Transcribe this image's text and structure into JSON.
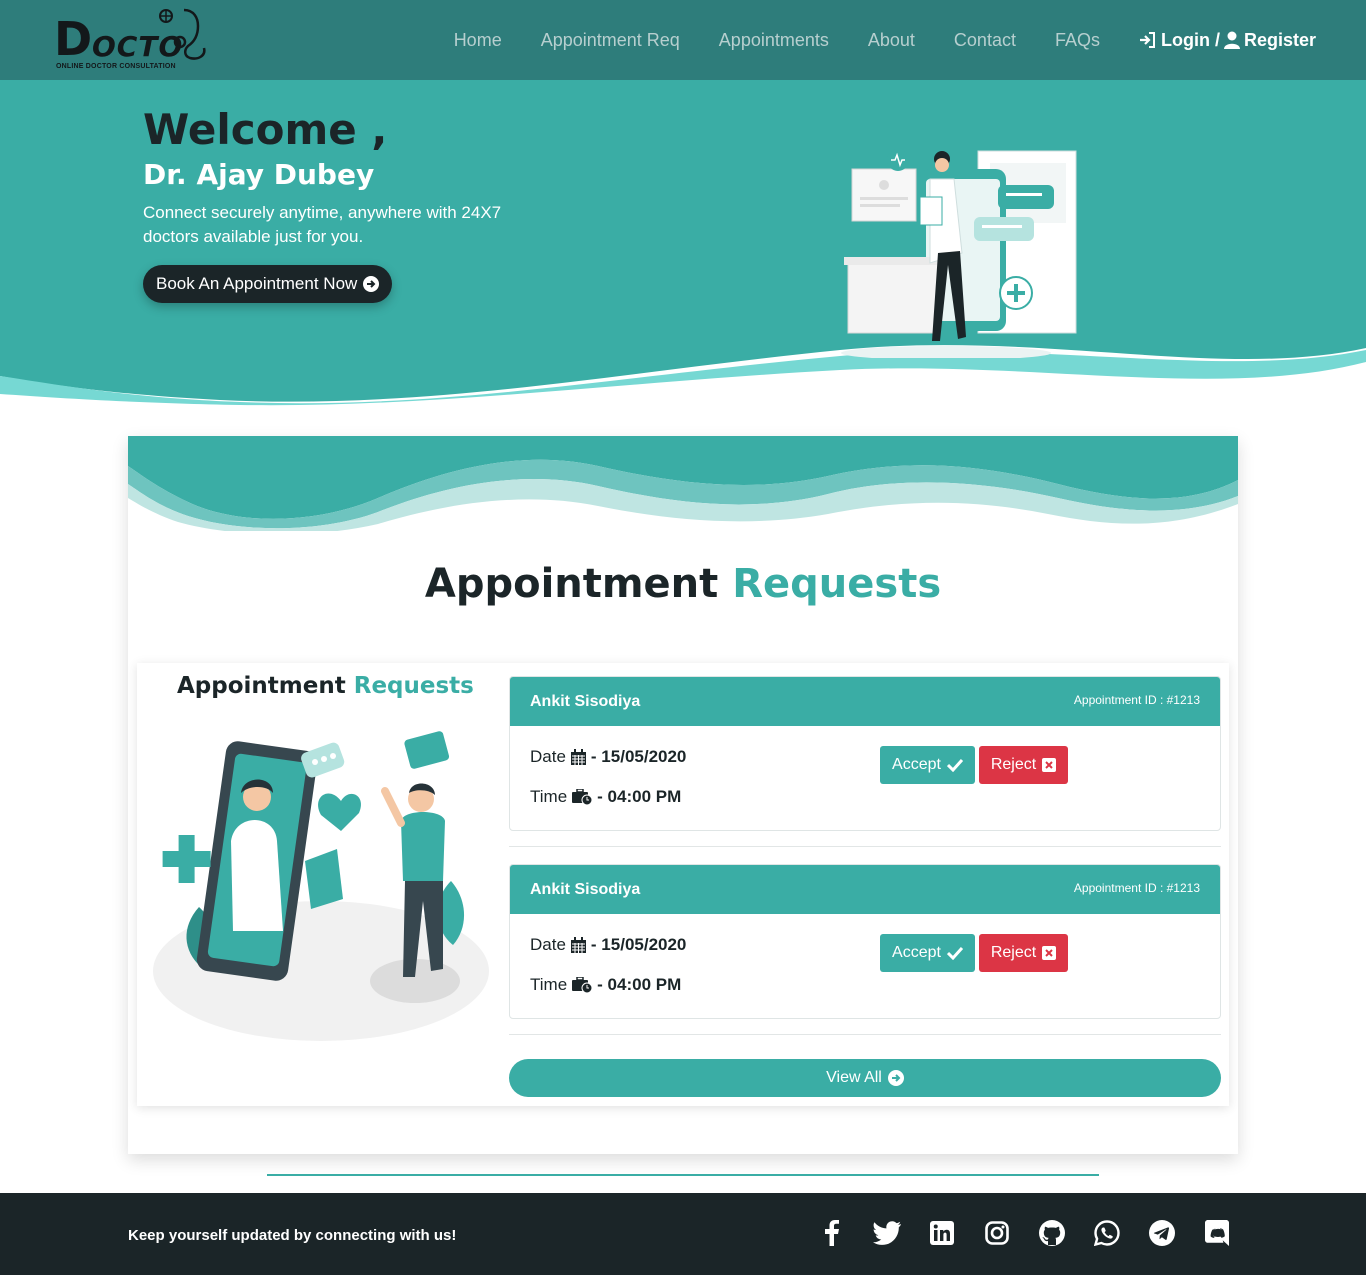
{
  "nav": {
    "logo_letter": "D",
    "logo_word": "OCTO",
    "logo_tagline": "ONLINE DOCTOR CONSULTATION",
    "links": [
      "Home",
      "Appointment Req",
      "Appointments",
      "About",
      "Contact",
      "FAQs"
    ],
    "login_label": "Login /",
    "register_label": "Register"
  },
  "hero": {
    "welcome": "Welcome ,",
    "doctor_name": "Dr. Ajay Dubey",
    "tagline": "Connect securely anytime, anywhere with 24X7 doctors available just for you.",
    "book_button": "Book An Appointment Now"
  },
  "section": {
    "title_dark": "Appointment",
    "title_accent": "Requests",
    "inner_title_dark": "Appointment",
    "inner_title_accent": "Requests"
  },
  "requests": [
    {
      "patient": "Ankit Sisodiya",
      "appointment_id": "Appointment ID : #1213",
      "date_label": "Date",
      "date_value": "- 15/05/2020",
      "time_label": "Time",
      "time_value": "- 04:00 PM",
      "accept_label": "Accept",
      "reject_label": "Reject"
    },
    {
      "patient": "Ankit Sisodiya",
      "appointment_id": "Appointment ID : #1213",
      "date_label": "Date",
      "date_value": "- 15/05/2020",
      "time_label": "Time",
      "time_value": "- 04:00 PM",
      "accept_label": "Accept",
      "reject_label": "Reject"
    }
  ],
  "view_all_label": "View All",
  "footer": {
    "text": "Keep yourself updated by connecting with us!",
    "social_icons": [
      "facebook-icon",
      "twitter-icon",
      "linkedin-icon",
      "instagram-icon",
      "github-icon",
      "whatsapp-icon",
      "telegram-icon",
      "discord-icon"
    ]
  },
  "colors": {
    "nav_bg": "#2e7d7b",
    "hero_teal": "#3aada5",
    "accent": "#3aada5",
    "dark": "#1b2528",
    "reject": "#dc3545",
    "wave_light": "#76d8d3"
  }
}
